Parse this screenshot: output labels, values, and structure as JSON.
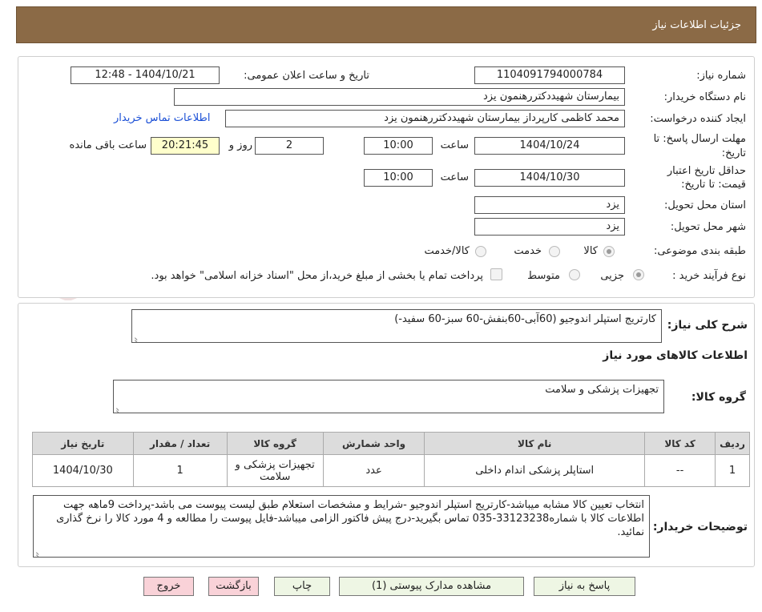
{
  "header": {
    "title": "جزئیات اطلاعات نیاز"
  },
  "watermark": {
    "text": "AriaTender.neT"
  },
  "form": {
    "need_number_label": "شماره نیاز:",
    "need_number": "1104091794000784",
    "announce_label": "تاریخ و ساعت اعلان عمومی:",
    "announce_value": "1404/10/21 - 12:48",
    "buyer_org_label": "نام دستگاه خریدار:",
    "buyer_org": "بیمارستان شهیددکتررهنمون یزد",
    "creator_label": "ایجاد کننده درخواست:",
    "creator": "محمد کاظمی کارپرداز بیمارستان شهیددکتررهنمون یزد",
    "contact_link": "اطلاعات تماس خریدار",
    "reply_deadline_label_1": "مهلت ارسال پاسخ: تا",
    "reply_deadline_label_2": "تاریخ:",
    "reply_date": "1404/10/24",
    "time_label": "ساعت",
    "reply_time": "10:00",
    "days_value": "2",
    "days_label": "روز و",
    "remaining_time": "20:21:45",
    "remaining_label": "ساعت باقی مانده",
    "validity_label_1": "حداقل تاریخ اعتبار",
    "validity_label_2": "قیمت: تا تاریخ:",
    "validity_date": "1404/10/30",
    "validity_time": "10:00",
    "province_label": "استان محل تحویل:",
    "province": "یزد",
    "city_label": "شهر محل تحویل:",
    "city": "یزد",
    "category_label": "طبقه بندی موضوعی:",
    "category_options": [
      "کالا",
      "خدمت",
      "کالا/خدمت"
    ],
    "category_selected": "کالا",
    "process_label": "نوع فرآیند خرید :",
    "process_options": [
      "جزیی",
      "متوسط"
    ],
    "payment_note": "پرداخت تمام یا بخشی از مبلغ خرید،از محل \"اسناد خزانه اسلامی\" خواهد بود."
  },
  "details": {
    "summary_label": "شرح کلی نیاز:",
    "summary": "کارتریج استپلر اندوجیو  (60آبی-60بنفش-60 سبز-60 سفید-)",
    "items_heading": "اطلاعات کالاهای مورد نیاز",
    "group_label": "گروه کالا:",
    "group": "تجهیزات پزشکی و سلامت",
    "table_headers": [
      "ردیف",
      "کد کالا",
      "نام کالا",
      "واحد شمارش",
      "گروه کالا",
      "تعداد / مقدار",
      "تاریخ نیاز"
    ],
    "table_rows": [
      [
        "1",
        "--",
        "استاپلر پزشکی اندام داخلی",
        "عدد",
        "تجهیزات پزشکی و سلامت",
        "1",
        "1404/10/30"
      ]
    ],
    "buyer_notes_label": "توضیحات خریدار:",
    "buyer_notes": "انتخاب تعیین کالا مشابه میباشد-کارتریج استپلر اندوجیو -شرایط و مشخصات استعلام طبق لیست پیوست می باشد-پرداخت 9ماهه جهت اطلاعات کالا با شماره33123238-035 تماس بگیرید-درج پیش فاکتور الزامی میباشد-فایل پیوست را مطالعه و 4 مورد کالا را نرخ گذاری نمائید."
  },
  "buttons": {
    "reply": "پاسخ به نیاز",
    "attachments": "مشاهده مدارک پیوستی (1)",
    "print": "چاپ",
    "back": "بازگشت",
    "exit": "خروج"
  },
  "colors": {
    "header": "#8b6a46",
    "link": "#1a4fd6",
    "button": "#eef6e4",
    "button_danger": "#f9d2d8",
    "remaining_bg": "#ffffcc"
  }
}
